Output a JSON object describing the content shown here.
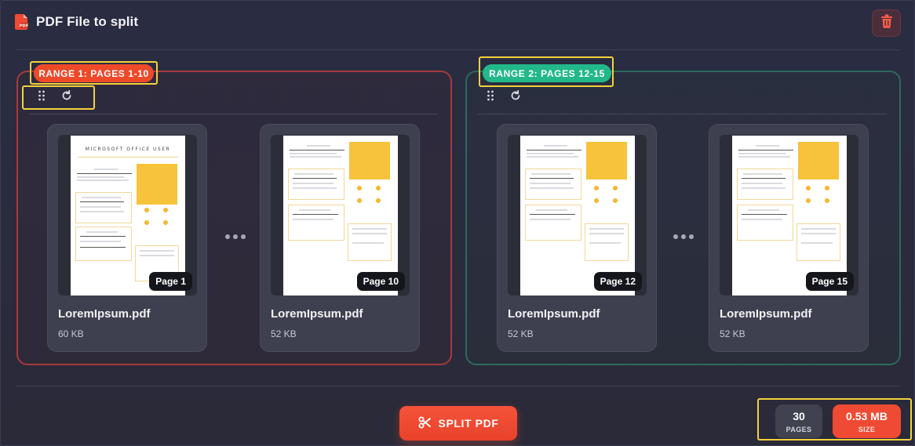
{
  "header": {
    "title": "PDF File to split",
    "icon": "pdf-file-icon",
    "delete_icon": "trash-icon"
  },
  "ranges": [
    {
      "label": "RANGE 1: PAGES 1-10",
      "color": "#ee4a2a",
      "cards": [
        {
          "file": "LoremIpsum.pdf",
          "size": "60 KB",
          "page": "Page 1",
          "doc_title": "MICROSOFT OFFICE USER"
        },
        {
          "file": "LoremIpsum.pdf",
          "size": "52 KB",
          "page": "Page 10"
        }
      ]
    },
    {
      "label": "RANGE 2: PAGES 12-15",
      "color": "#22b889",
      "cards": [
        {
          "file": "LoremIpsum.pdf",
          "size": "52 KB",
          "page": "Page 12"
        },
        {
          "file": "LoremIpsum.pdf",
          "size": "52 KB",
          "page": "Page 15"
        }
      ]
    }
  ],
  "tools": {
    "drag_icon": "drag-handle-icon",
    "rotate_icon": "rotate-icon"
  },
  "actions": {
    "split_label": "SPLIT PDF",
    "split_icon": "scissors-icon"
  },
  "stats": {
    "pages_value": "30",
    "pages_label": "PAGES",
    "size_value": "0.53 MB",
    "size_label": "SIZE"
  },
  "colors": {
    "accent": "#ef4a33",
    "green": "#22b889",
    "highlight": "#f3d23b"
  }
}
